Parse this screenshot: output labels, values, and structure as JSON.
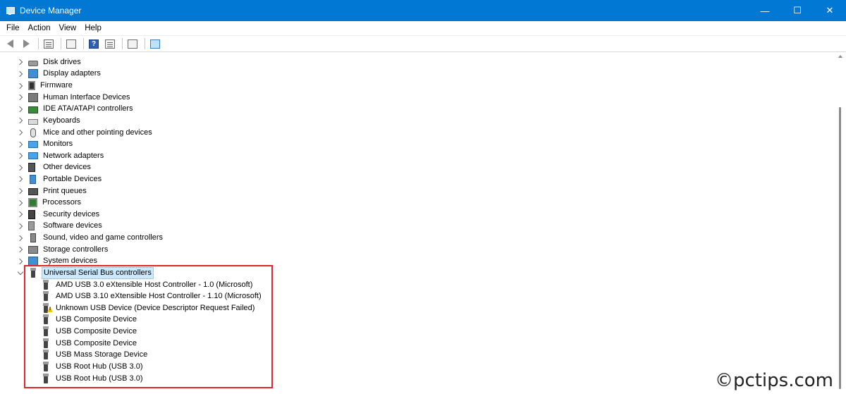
{
  "window": {
    "title": "Device Manager",
    "controls": {
      "minimize": "—",
      "maximize": "☐",
      "close": "✕"
    }
  },
  "menu": [
    "File",
    "Action",
    "View",
    "Help"
  ],
  "toolbar": {
    "help_glyph": "?",
    "buttons": [
      "back-icon",
      "forward-icon",
      "device-list-icon",
      "properties-icon",
      "help-icon",
      "grid-icon",
      "update-driver-icon",
      "scan-hardware-icon"
    ]
  },
  "tree": {
    "categories": [
      {
        "label": "Disk drives",
        "icon": "disk-drive-icon"
      },
      {
        "label": "Display adapters",
        "icon": "display-adapter-icon"
      },
      {
        "label": "Firmware",
        "icon": "firmware-icon"
      },
      {
        "label": "Human Interface Devices",
        "icon": "hid-icon"
      },
      {
        "label": "IDE ATA/ATAPI controllers",
        "icon": "ide-controller-icon"
      },
      {
        "label": "Keyboards",
        "icon": "keyboard-icon"
      },
      {
        "label": "Mice and other pointing devices",
        "icon": "mouse-icon"
      },
      {
        "label": "Monitors",
        "icon": "monitor-icon"
      },
      {
        "label": "Network adapters",
        "icon": "network-adapter-icon"
      },
      {
        "label": "Other devices",
        "icon": "other-devices-icon"
      },
      {
        "label": "Portable Devices",
        "icon": "portable-device-icon"
      },
      {
        "label": "Print queues",
        "icon": "printer-icon"
      },
      {
        "label": "Processors",
        "icon": "processor-icon"
      },
      {
        "label": "Security devices",
        "icon": "security-device-icon"
      },
      {
        "label": "Software devices",
        "icon": "software-device-icon"
      },
      {
        "label": "Sound, video and game controllers",
        "icon": "sound-icon"
      },
      {
        "label": "Storage controllers",
        "icon": "storage-controller-icon"
      },
      {
        "label": "System devices",
        "icon": "system-device-icon"
      }
    ],
    "usb": {
      "label": "Universal Serial Bus controllers",
      "expanded": true,
      "selected": true,
      "children": [
        {
          "label": "AMD USB 3.0 eXtensible Host Controller - 1.0 (Microsoft)",
          "warning": false
        },
        {
          "label": "AMD USB 3.10 eXtensible Host Controller - 1.10 (Microsoft)",
          "warning": false
        },
        {
          "label": "Unknown USB Device (Device Descriptor Request Failed)",
          "warning": true
        },
        {
          "label": "USB Composite Device",
          "warning": false
        },
        {
          "label": "USB Composite Device",
          "warning": false
        },
        {
          "label": "USB Composite Device",
          "warning": false
        },
        {
          "label": "USB Mass Storage Device",
          "warning": false
        },
        {
          "label": "USB Root Hub (USB 3.0)",
          "warning": false
        },
        {
          "label": "USB Root Hub (USB 3.0)",
          "warning": false
        }
      ]
    }
  },
  "watermark": "©pctips.com",
  "colors": {
    "titlebar": "#0078d4",
    "highlight": "#e0252f",
    "selection": "#cce8ff"
  }
}
